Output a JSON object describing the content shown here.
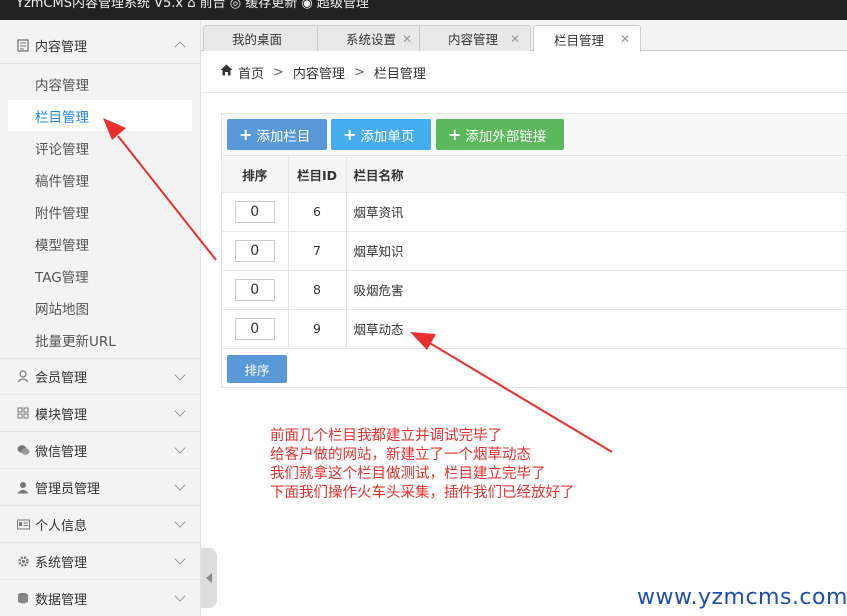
{
  "topbar": {
    "text": "YzmCMS内容管理系统 V5.x   ⌂ 前台    ◎ 缓存更新    ◉ 超级管理"
  },
  "sidebar": {
    "content_section": {
      "label": "内容管理",
      "icon": "document-icon"
    },
    "items": [
      {
        "label": "内容管理"
      },
      {
        "label": "栏目管理",
        "active": true
      },
      {
        "label": "评论管理"
      },
      {
        "label": "稿件管理"
      },
      {
        "label": "附件管理"
      },
      {
        "label": "模型管理"
      },
      {
        "label": "TAG管理"
      },
      {
        "label": "网站地图"
      },
      {
        "label": "批量更新URL"
      }
    ],
    "sections": [
      {
        "label": "会员管理",
        "icon": "user-icon"
      },
      {
        "label": "模块管理",
        "icon": "grid-icon"
      },
      {
        "label": "微信管理",
        "icon": "wechat-icon"
      },
      {
        "label": "管理员管理",
        "icon": "admin-icon"
      },
      {
        "label": "个人信息",
        "icon": "id-card-icon"
      },
      {
        "label": "系统管理",
        "icon": "gear-icon"
      },
      {
        "label": "数据管理",
        "icon": "database-icon"
      }
    ]
  },
  "tabs": [
    {
      "label": "我的桌面"
    },
    {
      "label": "系统设置"
    },
    {
      "label": "内容管理"
    },
    {
      "label": "栏目管理",
      "active": true
    }
  ],
  "breadcrumb": {
    "home": "首页",
    "level1": "内容管理",
    "level2": "栏目管理",
    "separator": ">"
  },
  "toolbar": {
    "add_category": "添加栏目",
    "add_page": "添加单页",
    "add_external_link": "添加外部链接"
  },
  "table": {
    "headers": {
      "order": "排序",
      "id": "栏目ID",
      "name": "栏目名称"
    },
    "rows": [
      {
        "order": "0",
        "id": "6",
        "name": "烟草资讯"
      },
      {
        "order": "0",
        "id": "7",
        "name": "烟草知识"
      },
      {
        "order": "0",
        "id": "8",
        "name": "吸烟危害"
      },
      {
        "order": "0",
        "id": "9",
        "name": "烟草动态"
      }
    ],
    "sort_button": "排序"
  },
  "annotation": {
    "lines": [
      "前面几个栏目我都建立并调试完毕了",
      "给客户做的网站，新建立了一个烟草动态",
      "我们就拿这个栏目做测试，栏目建立完毕了",
      "下面我们操作火车头采集，插件我们已经放好了"
    ],
    "color": "#e8312f"
  },
  "watermark": "www.yzmcms.com",
  "colors": {
    "primary_button": "#5a99d8",
    "light_blue_button": "#45acef",
    "green_button": "#5cb85c",
    "active_link": "#1e88e5"
  }
}
